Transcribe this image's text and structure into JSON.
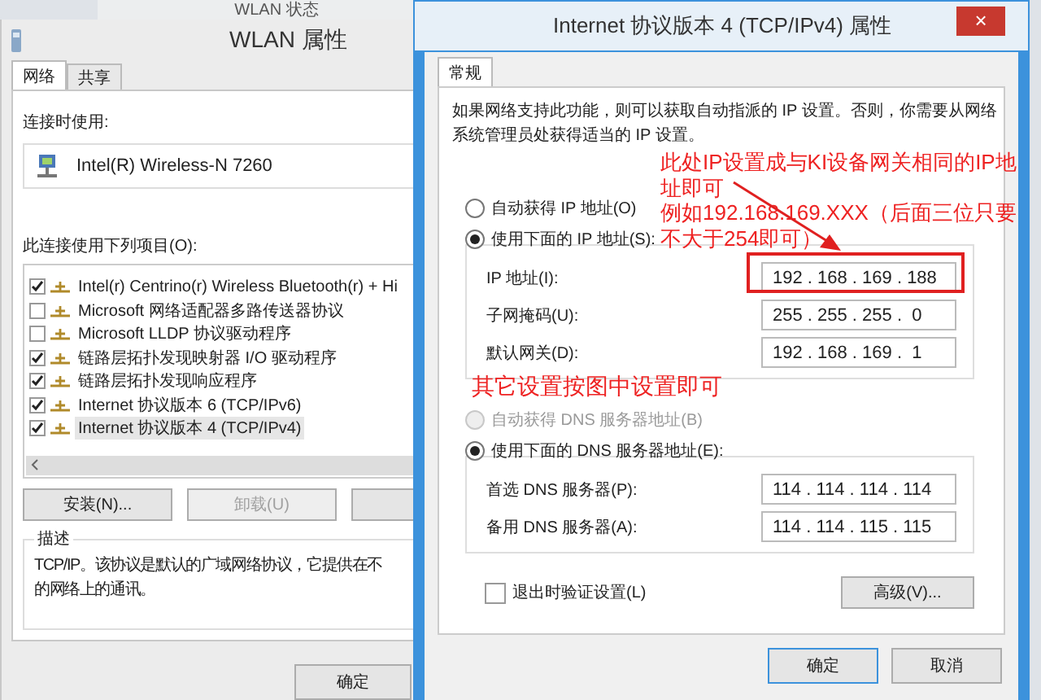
{
  "back_window": {
    "title": "WLAN 状态"
  },
  "wlan_window": {
    "title": "WLAN 属性",
    "tabs": [
      {
        "label": "网络",
        "selected": true
      },
      {
        "label": "共享",
        "selected": false
      }
    ],
    "connect_using_label": "连接时使用:",
    "adapter": "Intel(R) Wireless-N 7260",
    "items_label": "此连接使用下列项目(O):",
    "items": [
      {
        "label": "Intel(r) Centrino(r) Wireless Bluetooth(r) + Hi",
        "checked": true,
        "selected": false
      },
      {
        "label": "Microsoft 网络适配器多路传送器协议",
        "checked": false,
        "selected": false
      },
      {
        "label": "Microsoft LLDP 协议驱动程序",
        "checked": false,
        "selected": false
      },
      {
        "label": "链路层拓扑发现映射器 I/O 驱动程序",
        "checked": true,
        "selected": false
      },
      {
        "label": "链路层拓扑发现响应程序",
        "checked": true,
        "selected": false
      },
      {
        "label": "Internet 协议版本 6 (TCP/IPv6)",
        "checked": true,
        "selected": false
      },
      {
        "label": "Internet 协议版本 4 (TCP/IPv4)",
        "checked": true,
        "selected": true
      }
    ],
    "buttons": [
      {
        "label": "安装(N)...",
        "disabled": false
      },
      {
        "label": "卸载(U)",
        "disabled": true
      }
    ],
    "description_title": "描述",
    "description_lines": [
      "TCP/IP。该协议是默认的广域网络协议，它提供在不",
      "的网络上的通讯。"
    ],
    "ok_button": "确定"
  },
  "ipv4_window": {
    "title": "Internet 协议版本 4 (TCP/IPv4) 属性",
    "tabs": [
      {
        "label": "常规",
        "selected": true
      }
    ],
    "intro_lines": [
      "如果网络支持此功能，则可以获取自动指派的 IP 设置。否则，你需要从网络",
      "系统管理员处获得适当的 IP 设置。"
    ],
    "ip_modes": [
      {
        "label": "自动获得 IP 地址(O)",
        "selected": false,
        "disabled": false
      },
      {
        "label": "使用下面的 IP 地址(S):",
        "selected": true,
        "disabled": false
      }
    ],
    "ip_fields": [
      {
        "label": "IP 地址(I):",
        "value": "192 . 168 . 169 . 188"
      },
      {
        "label": "子网掩码(U):",
        "value": "255 . 255 . 255 .  0"
      },
      {
        "label": "默认网关(D):",
        "value": "192 . 168 . 169 .  1"
      }
    ],
    "dns_modes": [
      {
        "label": "自动获得 DNS 服务器地址(B)",
        "selected": false,
        "disabled": true
      },
      {
        "label": "使用下面的 DNS 服务器地址(E):",
        "selected": true,
        "disabled": false
      }
    ],
    "dns_fields": [
      {
        "label": "首选 DNS 服务器(P):",
        "value": "114 . 114 . 114 . 114"
      },
      {
        "label": "备用 DNS 服务器(A):",
        "value": "114 . 114 . 115 . 115"
      }
    ],
    "validate": {
      "label": "退出时验证设置(L)",
      "checked": false
    },
    "advanced_button": "高级(V)...",
    "buttons": [
      "确定",
      "取消"
    ],
    "close_button": "×"
  },
  "annotations": {
    "note_lines": [
      "此处IP设置成与KI设备网关相同的IP地",
      "址即可",
      "例如192.168.169.XXX（后面三位只要",
      "不大于254即可）"
    ],
    "other_note": "其它设置按图中设置即可"
  }
}
